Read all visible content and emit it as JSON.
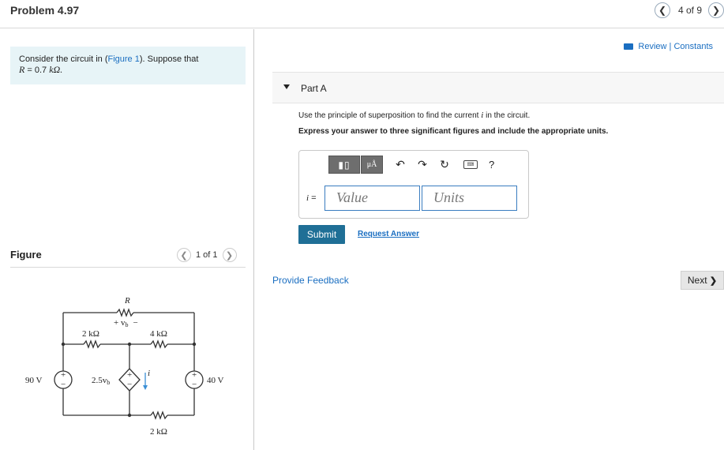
{
  "header": {
    "title": "Problem 4.97",
    "page_indicator": "4 of 9",
    "prev_icon": "chevron-left-icon",
    "next_icon": "chevron-right-icon"
  },
  "intro": {
    "text_before": "Consider the circuit in (",
    "figure_link": "Figure 1",
    "text_after": "). Suppose that",
    "r_symbol": "R",
    "r_equals": " = 0.7 ",
    "r_unit": "kΩ."
  },
  "figure": {
    "heading": "Figure",
    "pager": "1 of 1",
    "labels": {
      "r": "R",
      "vb": "+ v",
      "vb_sub": "b",
      "vb_minus": "−",
      "r2k_left": "2 kΩ",
      "r4k": "4 kΩ",
      "r2k_bottom": "2 kΩ",
      "dep": "2.5v",
      "dep_sub": "b",
      "v90": "90 V",
      "v40": "40 V",
      "i": "i",
      "plus": "+",
      "minus": "−"
    }
  },
  "links": {
    "review": "Review",
    "separator": " | ",
    "constants": "Constants"
  },
  "part": {
    "label": "Part A",
    "instruction_before": "Use the principle of superposition to find the current ",
    "instruction_var": "i",
    "instruction_after": " in the circuit.",
    "instruction_bold": "Express your answer to three significant figures and include the appropriate units."
  },
  "answer": {
    "template_icon": "▮▯",
    "unit_symbol": "μÅ",
    "undo_icon": "↶",
    "redo_icon": "↷",
    "reset_icon": "↻",
    "keyboard_icon": "⌨",
    "help_icon": "?",
    "eq_var": "i",
    "eq_sign": " =",
    "value_placeholder": "Value",
    "units_placeholder": "Units"
  },
  "actions": {
    "submit": "Submit",
    "request_answer": "Request Answer",
    "provide_feedback": "Provide Feedback",
    "next": "Next",
    "next_icon": "❯"
  }
}
